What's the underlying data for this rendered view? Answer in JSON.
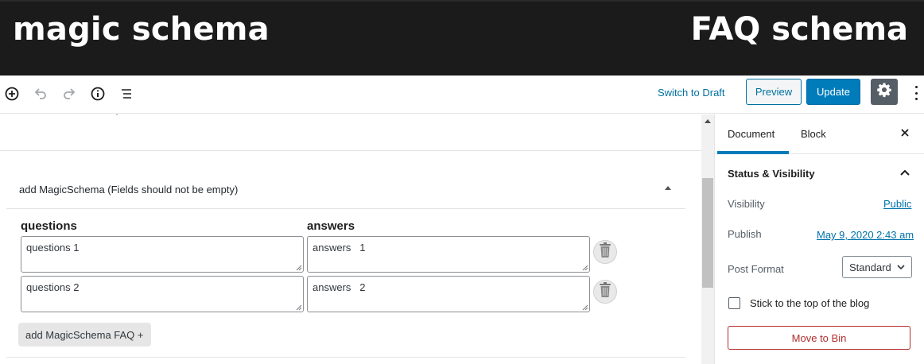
{
  "banner": {
    "left_title": "magic schema",
    "right_title": "FAQ schema"
  },
  "toolbar": {
    "icons": [
      "add-block-icon",
      "undo-icon",
      "redo-icon",
      "info-icon",
      "list-view-icon"
    ],
    "switch_to_draft": "Switch to Draft",
    "preview": "Preview",
    "update": "Update",
    "settings_icon": "gear-icon",
    "more_icon": "more-vertical-icon"
  },
  "metabox": {
    "title": "add MagicSchema (Fields should not be empty)",
    "questions_header": "questions",
    "answers_header": "answers",
    "rows": [
      {
        "question": "questions 1",
        "answer": "answers   1"
      },
      {
        "question": "questions 2",
        "answer": "answers   2"
      }
    ],
    "add_button": "add MagicSchema FAQ +"
  },
  "sidebar": {
    "tabs": [
      {
        "label": "Document",
        "active": true
      },
      {
        "label": "Block",
        "active": false
      }
    ],
    "section_title": "Status & Visibility",
    "visibility_label": "Visibility",
    "visibility_value": "Public",
    "publish_label": "Publish",
    "publish_value": "May 9, 2020 2:43 am",
    "post_format_label": "Post Format",
    "post_format_value": "Standard",
    "sticky_label": "Stick to the top of the blog",
    "sticky_checked": false,
    "move_to_bin": "Move to Bin"
  },
  "colors": {
    "accent": "#007cba",
    "link": "#0073aa",
    "danger": "#b32d2e",
    "banner_bg": "#1b1b1b"
  }
}
